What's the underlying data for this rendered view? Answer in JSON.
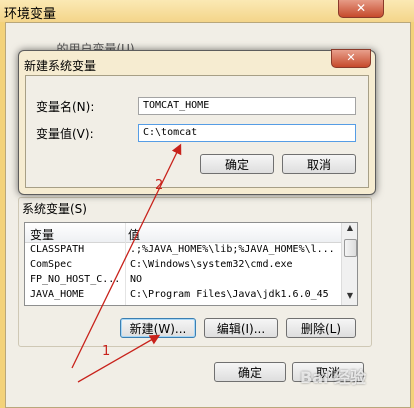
{
  "outer": {
    "title": "环境变量",
    "close": "✕",
    "user_section_label": "...的用户变量(U)",
    "system_section_label": "系统变量(S)",
    "columns": [
      "变量",
      "值"
    ],
    "rows": [
      {
        "name": "CLASSPATH",
        "value": ".;%JAVA_HOME%\\lib;%JAVA_HOME%\\l..."
      },
      {
        "name": "ComSpec",
        "value": "C:\\Windows\\system32\\cmd.exe"
      },
      {
        "name": "FP_NO_HOST_C...",
        "value": "NO"
      },
      {
        "name": "JAVA_HOME",
        "value": "C:\\Program Files\\Java\\jdk1.6.0_45"
      }
    ],
    "new_button": "新建(W)...",
    "edit_button": "编辑(I)...",
    "delete_button": "删除(L)",
    "ok_button": "确定",
    "cancel_button": "取消"
  },
  "dialog": {
    "title": "新建系统变量",
    "close": "✕",
    "name_label": "变量名(N):",
    "name_value": "TOMCAT_HOME",
    "value_label": "变量值(V):",
    "value_value": "C:\\tomcat",
    "ok_button": "确定",
    "cancel_button": "取消"
  },
  "annotations": {
    "step1": "1",
    "step2": "2",
    "color": "#c8221b"
  },
  "watermark": "Bai 经验"
}
